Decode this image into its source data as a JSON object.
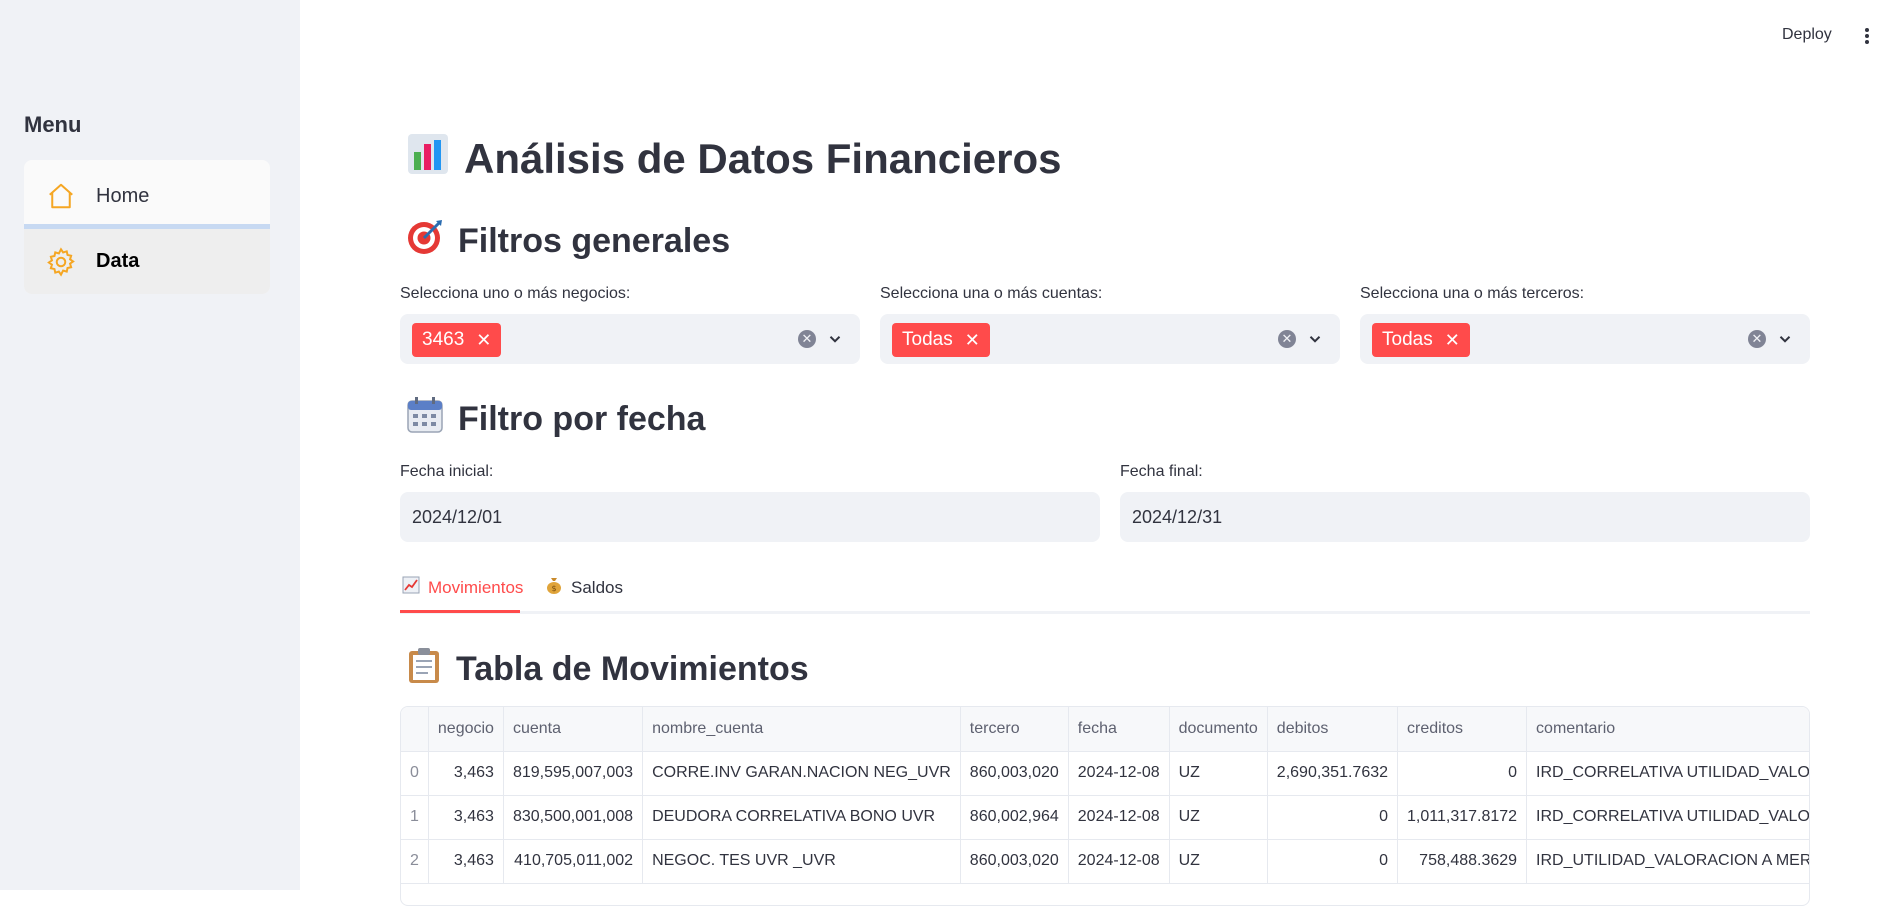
{
  "sidebar": {
    "title": "Menu",
    "items": [
      {
        "label": "Home",
        "icon": "house-icon"
      },
      {
        "label": "Data",
        "icon": "gear-icon"
      }
    ]
  },
  "header": {
    "deploy_label": "Deploy"
  },
  "page": {
    "title": "Análisis de Datos Financieros",
    "filters_heading": "Filtros generales",
    "date_heading": "Filtro por fecha",
    "table_heading": "Tabla de Movimientos"
  },
  "filters": [
    {
      "label": "Selecciona uno o más negocios:",
      "chip": "3463"
    },
    {
      "label": "Selecciona una o más cuentas:",
      "chip": "Todas"
    },
    {
      "label": "Selecciona una o más terceros:",
      "chip": "Todas"
    }
  ],
  "dates": {
    "start_label": "Fecha inicial:",
    "start_value": "2024/12/01",
    "end_label": "Fecha final:",
    "end_value": "2024/12/31"
  },
  "tabs": [
    {
      "label": "Movimientos",
      "icon": "chart-increasing-icon",
      "active": true
    },
    {
      "label": "Saldos",
      "icon": "money-bag-icon",
      "active": false
    }
  ],
  "table": {
    "columns": [
      "",
      "negocio",
      "cuenta",
      "nombre_cuenta",
      "tercero",
      "fecha",
      "documento",
      "debitos",
      "creditos",
      "comentario"
    ],
    "rows": [
      [
        "0",
        "3,463",
        "819,595,007,003",
        "CORRE.INV GARAN.NACION NEG_UVR",
        "860,003,020",
        "2024-12-08",
        "UZ",
        "2,690,351.7632",
        "0",
        "IRD_CORRELATIVA UTILIDAD_VALORACION"
      ],
      [
        "1",
        "3,463",
        "830,500,001,008",
        "DEUDORA CORRELATIVA BONO UVR",
        "860,002,964",
        "2024-12-08",
        "UZ",
        "0",
        "1,011,317.8172",
        "IRD_CORRELATIVA UTILIDAD_VALORACION"
      ],
      [
        "2",
        "3,463",
        "410,705,011,002",
        "NEGOC. TES UVR _UVR",
        "860,003,020",
        "2024-12-08",
        "UZ",
        "0",
        "758,488.3629",
        "IRD_UTILIDAD_VALORACION A MERCADO"
      ]
    ]
  },
  "colors": {
    "accent": "#ff4b4b",
    "sidebar_bg": "#f0f2f6",
    "icon_orange": "#f5a623"
  }
}
